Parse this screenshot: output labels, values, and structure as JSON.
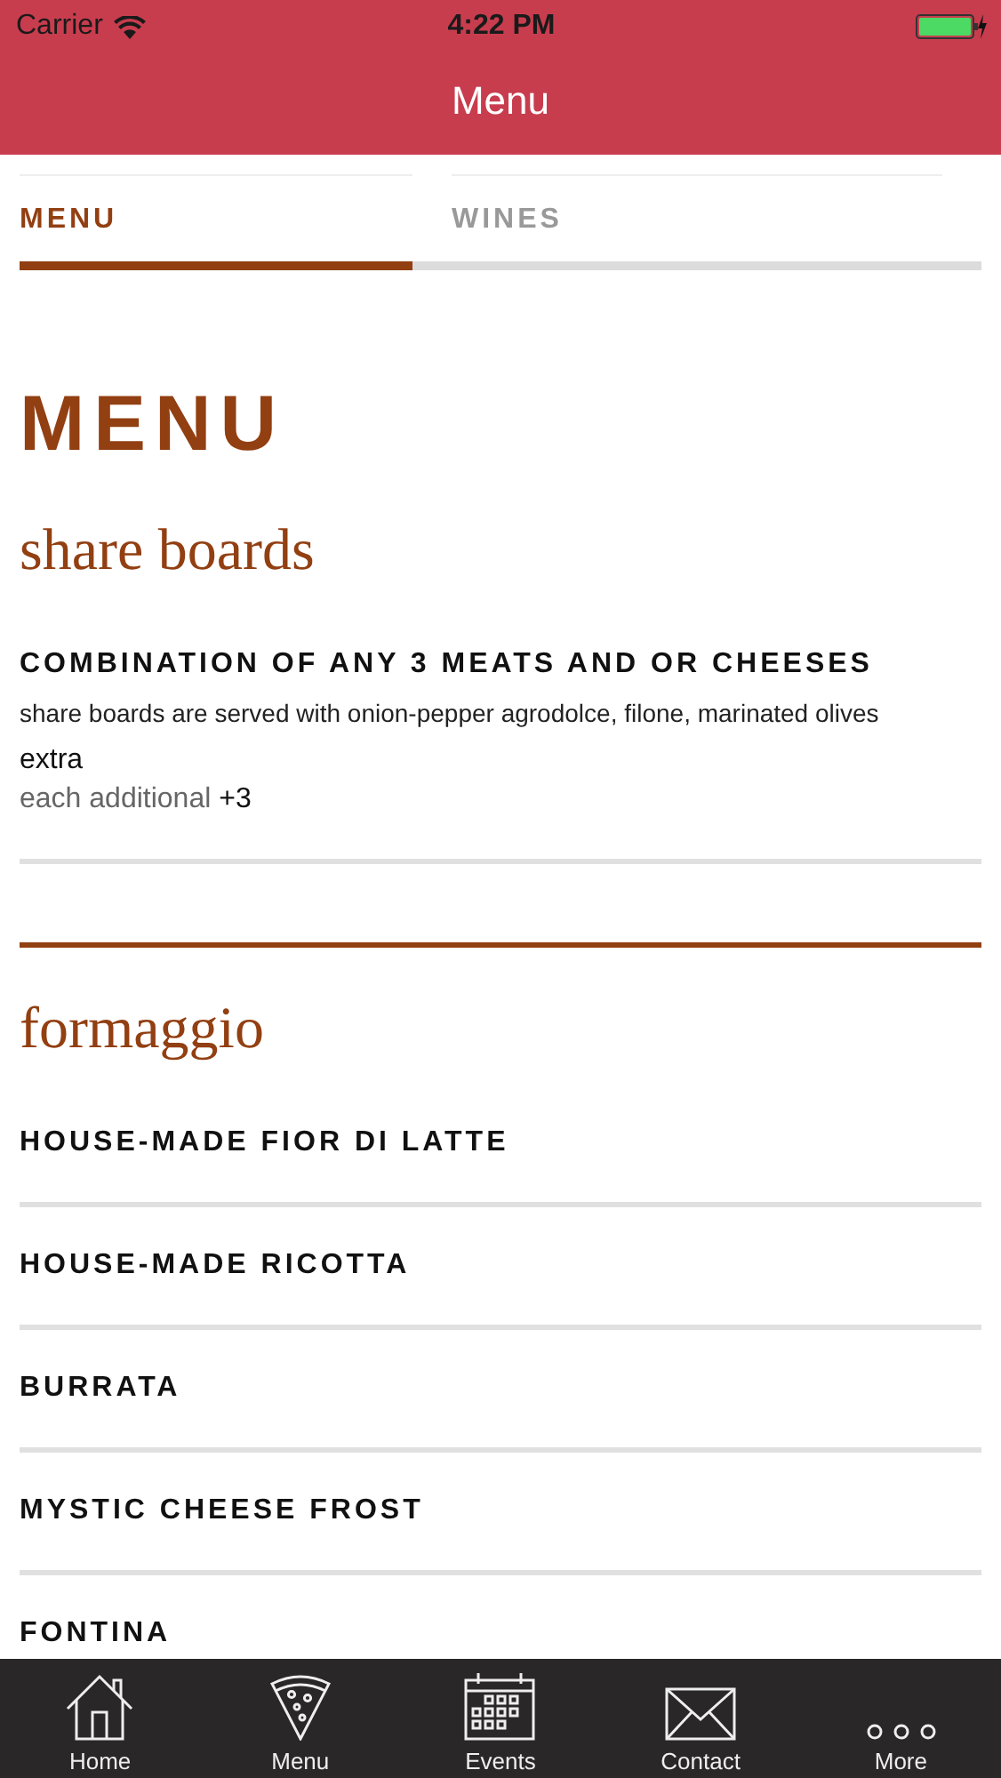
{
  "status_bar": {
    "carrier": "Carrier",
    "time": "4:22 PM"
  },
  "nav": {
    "title": "Menu"
  },
  "tabs": [
    {
      "label": "MENU",
      "selected": true
    },
    {
      "label": "WINES",
      "selected": false
    }
  ],
  "heading": "MENU",
  "sections": [
    {
      "title": "share boards",
      "items": [
        {
          "name": "COMBINATION OF ANY 3 MEATS AND OR CHEESES",
          "description": "share boards are served with onion-pepper agrodolce, filone, marinated olives",
          "extra_label": "extra",
          "extra_text": "each additional",
          "extra_price": "+3"
        }
      ]
    },
    {
      "title": "formaggio",
      "items": [
        {
          "name": "HOUSE-MADE FIOR DI LATTE"
        },
        {
          "name": "HOUSE-MADE RICOTTA"
        },
        {
          "name": "BURRATA"
        },
        {
          "name": "MYSTIC CHEESE FROST"
        },
        {
          "name": "FONTINA"
        }
      ]
    }
  ],
  "tab_bar": [
    {
      "label": "Home",
      "kind": "home"
    },
    {
      "label": "Menu",
      "kind": "pizza"
    },
    {
      "label": "Events",
      "kind": "calendar"
    },
    {
      "label": "Contact",
      "kind": "mail"
    },
    {
      "label": "More",
      "kind": "more"
    }
  ]
}
